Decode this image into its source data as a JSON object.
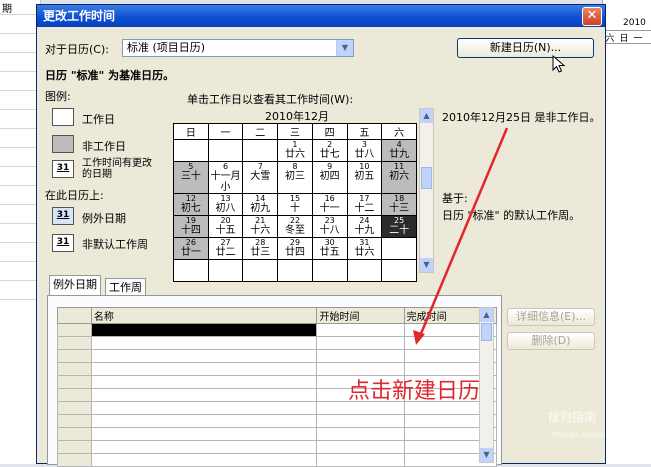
{
  "background": {
    "left_header": "期",
    "right_header_top": "2010",
    "right_header_days": [
      "六",
      "日",
      "一"
    ]
  },
  "dialog": {
    "title": "更改工作时间",
    "close_glyph": "✕",
    "for_calendar_label": "对于日历(C):",
    "calendar_select_value": "标准 (项目日历)",
    "new_calendar_button": "新建日历(N)...",
    "base_calendar_text": "日历 \"标准\" 为基准日历。",
    "legend": {
      "title": "图例:",
      "working_day": "工作日",
      "nonworking_day": "非工作日",
      "edited_hours_num": "31",
      "edited_hours": "工作时间有更改的日期",
      "on_this_calendar": "在此日历上:",
      "exception_num": "31",
      "exception_day": "例外日期",
      "nondefault_num": "31",
      "nondefault_week": "非默认工作周"
    },
    "click_hint": "单击工作日以查看其工作时间(W):",
    "calendar": {
      "month_title": "2010年12月",
      "weekdays": [
        "日",
        "一",
        "二",
        "三",
        "四",
        "五",
        "六"
      ],
      "weeks": [
        [
          {
            "d": "",
            "l": "",
            "t": "empty"
          },
          {
            "d": "",
            "l": "",
            "t": "empty"
          },
          {
            "d": "",
            "l": "",
            "t": "empty"
          },
          {
            "d": "1",
            "l": "廿六",
            "t": "w"
          },
          {
            "d": "2",
            "l": "廿七",
            "t": "w"
          },
          {
            "d": "3",
            "l": "廿八",
            "t": "w"
          },
          {
            "d": "4",
            "l": "廿九",
            "t": "nw"
          }
        ],
        [
          {
            "d": "5",
            "l": "三十",
            "t": "nw"
          },
          {
            "d": "6",
            "l": "十一月小",
            "t": "w"
          },
          {
            "d": "7",
            "l": "大雪",
            "t": "w"
          },
          {
            "d": "8",
            "l": "初三",
            "t": "w"
          },
          {
            "d": "9",
            "l": "初四",
            "t": "w"
          },
          {
            "d": "10",
            "l": "初五",
            "t": "w"
          },
          {
            "d": "11",
            "l": "初六",
            "t": "nw"
          }
        ],
        [
          {
            "d": "12",
            "l": "初七",
            "t": "nw"
          },
          {
            "d": "13",
            "l": "初八",
            "t": "w"
          },
          {
            "d": "14",
            "l": "初九",
            "t": "w"
          },
          {
            "d": "15",
            "l": "十",
            "t": "w"
          },
          {
            "d": "16",
            "l": "十一",
            "t": "w"
          },
          {
            "d": "17",
            "l": "十二",
            "t": "w"
          },
          {
            "d": "18",
            "l": "十三",
            "t": "nw"
          }
        ],
        [
          {
            "d": "19",
            "l": "十四",
            "t": "nw"
          },
          {
            "d": "20",
            "l": "十五",
            "t": "w"
          },
          {
            "d": "21",
            "l": "十六",
            "t": "w"
          },
          {
            "d": "22",
            "l": "冬至",
            "t": "w"
          },
          {
            "d": "23",
            "l": "十八",
            "t": "w"
          },
          {
            "d": "24",
            "l": "十九",
            "t": "w"
          },
          {
            "d": "25",
            "l": "二十",
            "t": "sel"
          }
        ],
        [
          {
            "d": "26",
            "l": "廿一",
            "t": "nw"
          },
          {
            "d": "27",
            "l": "廿二",
            "t": "w"
          },
          {
            "d": "28",
            "l": "廿三",
            "t": "w"
          },
          {
            "d": "29",
            "l": "廿四",
            "t": "w"
          },
          {
            "d": "30",
            "l": "廿五",
            "t": "w"
          },
          {
            "d": "31",
            "l": "廿六",
            "t": "w"
          },
          {
            "d": "",
            "l": "",
            "t": "empty"
          }
        ],
        [
          {
            "d": "",
            "l": "",
            "t": "empty"
          },
          {
            "d": "",
            "l": "",
            "t": "empty"
          },
          {
            "d": "",
            "l": "",
            "t": "empty"
          },
          {
            "d": "",
            "l": "",
            "t": "empty"
          },
          {
            "d": "",
            "l": "",
            "t": "empty"
          },
          {
            "d": "",
            "l": "",
            "t": "empty"
          },
          {
            "d": "",
            "l": "",
            "t": "empty"
          }
        ]
      ]
    },
    "selected_date_info": "2010年12月25日 是非工作日。",
    "based_on_label": "基于:",
    "based_on_text": "日历 \"标准\" 的默认工作周。",
    "tabs": [
      "例外日期",
      "工作周"
    ],
    "columns": [
      "名称",
      "开始时间",
      "完成时间"
    ],
    "details_button": "详细信息(E)...",
    "delete_button": "删除(D)"
  },
  "annotation": "点击新建日历",
  "watermark": "搜狗指南",
  "watermark_url": "zhinan.sogou.com",
  "colors": {
    "annotation": "#e2262d",
    "titlebar": "#0b4ed3",
    "nonworking": "#bcbcbc",
    "selected": "#2b2b2b"
  }
}
